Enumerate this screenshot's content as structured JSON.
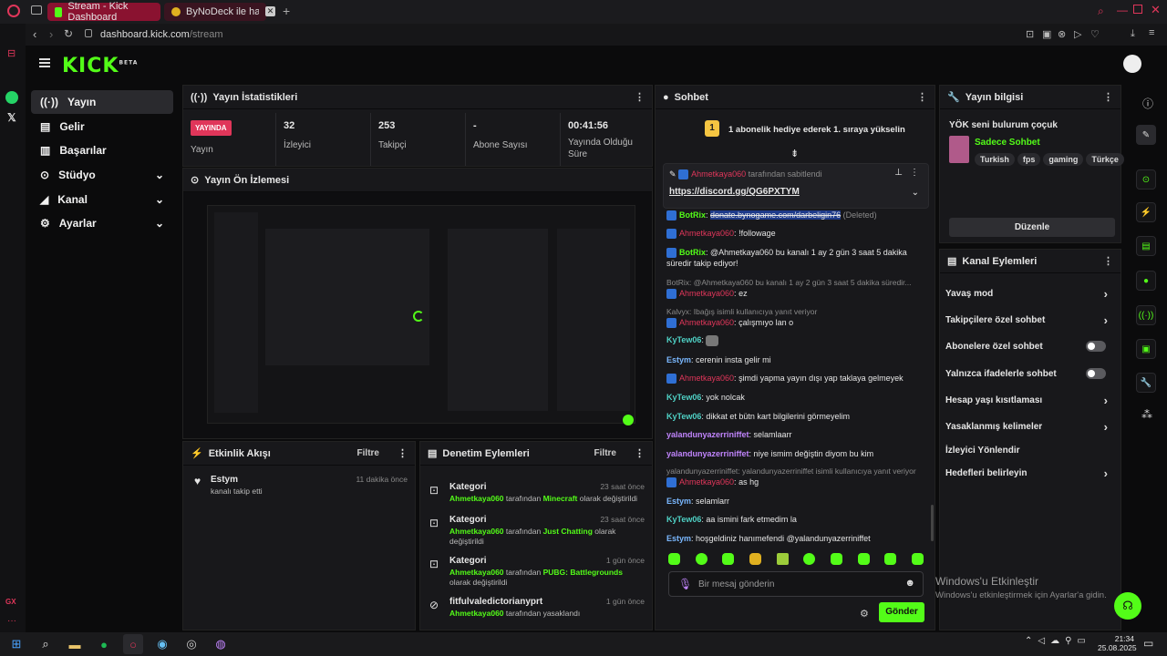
{
  "browser": {
    "tabs": [
      {
        "label": "Stream - Kick Dashboard"
      },
      {
        "label": "ByNoDeck ile harika..."
      }
    ],
    "url_host": "dashboard.kick.com",
    "url_path": "/stream"
  },
  "sidebar": {
    "items": [
      {
        "label": "Yayın"
      },
      {
        "label": "Gelir"
      },
      {
        "label": "Başarılar"
      },
      {
        "label": "Stüdyo"
      },
      {
        "label": "Kanal"
      },
      {
        "label": "Ayarlar"
      }
    ]
  },
  "stats": {
    "title": "Yayın İstatistikleri",
    "live_badge": "YAYINDA",
    "live_label": "Yayın",
    "items": [
      {
        "value": "32",
        "label": "İzleyici"
      },
      {
        "value": "253",
        "label": "Takipçi"
      },
      {
        "value": "-",
        "label": "Abone Sayısı"
      },
      {
        "value": "00:41:56",
        "label": "Yayında Olduğu Süre"
      }
    ]
  },
  "preview": {
    "title": "Yayın Ön İzlemesi"
  },
  "activity": {
    "title": "Etkinlik Akışı",
    "filter": "Filtre",
    "events": [
      {
        "user": "Estym",
        "desc": "kanalı takip etti",
        "time": "11 dakika önce"
      }
    ]
  },
  "moderation": {
    "title": "Denetim Eylemleri",
    "filter": "Filtre",
    "events": [
      {
        "title": "Kategori",
        "user": "Ahmetkaya060",
        "mid": "tarafından",
        "target": "Minecraft",
        "tail": "olarak değiştirildi",
        "time": "23 saat önce"
      },
      {
        "title": "Kategori",
        "user": "Ahmetkaya060",
        "mid": "tarafından",
        "target": "Just Chatting",
        "tail": "olarak değiştirildi",
        "time": "23 saat önce"
      },
      {
        "title": "Kategori",
        "user": "Ahmetkaya060",
        "mid": "tarafından",
        "target": "PUBG: Battlegrounds",
        "tail": "olarak değiştirildi",
        "time": "1 gün önce"
      },
      {
        "title": "fitfulvaledictorianyprt",
        "user": "Ahmetkaya060",
        "mid": "tarafından yasaklandı",
        "target": "",
        "tail": "",
        "time": "1 gün önce"
      }
    ]
  },
  "chat": {
    "title": "Sohbet",
    "gift_text": "1 abonelik hediye ederek 1. sıraya yükselin",
    "gift_rank": "1",
    "pinned_user": "Ahmetkaya060",
    "pinned_by": "tarafından sabitlendi",
    "pinned_link": "https://discord.gg/QG6PXTYM",
    "messages": [
      {
        "user": "BotRix",
        "text": "donate.bynogame.com/darbeligin76",
        "suffix": "(Deleted)"
      },
      {
        "user": "Ahmetkaya060",
        "text": "!followage"
      },
      {
        "user": "BotRix",
        "text": "@Ahmetkaya060 bu kanalı 1 ay 2 gün 3 saat 5 dakika süredir takip ediyor!"
      },
      {
        "reply": "BotRix: @Ahmetkaya060 bu kanalı 1 ay 2 gün 3 saat 5 dakika süredir..."
      },
      {
        "user": "Ahmetkaya060",
        "text": "ez"
      },
      {
        "reply": "Kalvyx: Ibağış isimli kullanıcıya yanıt veriyor"
      },
      {
        "user": "Ahmetkaya060",
        "text": "çalışmıyo lan o"
      },
      {
        "user": "KyTew06",
        "text": ""
      },
      {
        "user": "Estym",
        "text": "cerenin insta gelir mi"
      },
      {
        "user": "Ahmetkaya060",
        "text": "şimdi yapma yayın dışı yap taklaya gelmeyek"
      },
      {
        "user": "KyTew06",
        "text": "yok nolcak"
      },
      {
        "user": "KyTew06",
        "text": "dikkat et bütn kart bilgilerini görmeyelim"
      },
      {
        "user": "yalandunyazerriniffet",
        "text": "selamlaarr"
      },
      {
        "user": "yalandunyazerriniffet",
        "text": "niye ismim değiştin diyom bu kim"
      },
      {
        "reply": "yalandunyazerriniffet: yalandunyazerriniffet isimli kullanıcıya yanıt veriyor"
      },
      {
        "user": "Ahmetkaya060",
        "text": "as hg"
      },
      {
        "user": "Estym",
        "text": "selamlarr"
      },
      {
        "user": "KyTew06",
        "text": "aa ismini fark etmedim la"
      },
      {
        "user": "Estym",
        "text": "hoşgeldiniz hanımefendi @yalandunyazerriniffet"
      }
    ],
    "input_placeholder": "Bir mesaj gönderin",
    "send": "Gönder"
  },
  "streaminfo": {
    "title": "Yayın bilgisi",
    "stream_title": "YÖK seni bulurum çoçuk",
    "category": "Sadece Sohbet",
    "tags": [
      "Turkish",
      "fps",
      "gaming",
      "Türkçe"
    ],
    "edit": "Düzenle"
  },
  "channel_actions": {
    "title": "Kanal Eylemleri",
    "items": [
      {
        "label": "Yavaş mod",
        "control": "chevron"
      },
      {
        "label": "Takipçilere özel sohbet",
        "control": "chevron"
      },
      {
        "label": "Abonelere özel sohbet",
        "control": "toggle"
      },
      {
        "label": "Yalnızca ifadelerle sohbet",
        "control": "toggle"
      },
      {
        "label": "Hesap yaşı kısıtlaması",
        "control": "chevron"
      },
      {
        "label": "Yasaklanmış kelimeler",
        "control": "chevron"
      },
      {
        "label": "İzleyici Yönlendir",
        "control": "none"
      },
      {
        "label": "Hedefleri belirleyin",
        "control": "chevron"
      }
    ]
  },
  "windows": {
    "activate_title": "Windows'u Etkinleştir",
    "activate_desc": "Windows'u etkinleştirmek için Ayarlar'a gidin."
  },
  "clock": {
    "time": "21:34",
    "date": "25.08.2025"
  },
  "colors": {
    "accent": "#53fc18",
    "live": "#e0365a",
    "panel": "#18181b"
  }
}
